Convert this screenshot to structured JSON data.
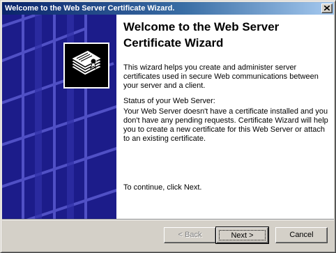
{
  "window": {
    "title": "Welcome to the Web Server Certificate Wizard."
  },
  "icons": {
    "close": "close-icon",
    "wizard_logo": "certificate-documents-icon"
  },
  "content": {
    "heading": "Welcome to the Web Server Certificate Wizard",
    "intro": "This wizard helps you create and administer server certificates used in secure Web communications between your server and a client.",
    "status_label": "Status of your Web Server:",
    "status_text": "Your Web Server doesn't have a certificate installed and you don't have any pending requests. Certificate Wizard will help you to create a new certificate for this Web Server or attach to an existing certificate.",
    "continue_text": "To continue, click Next."
  },
  "buttons": {
    "back": "< Back",
    "next": "Next >",
    "cancel": "Cancel"
  },
  "colors": {
    "title_start": "#0a246a",
    "sidebar": "#1c1c8a"
  }
}
